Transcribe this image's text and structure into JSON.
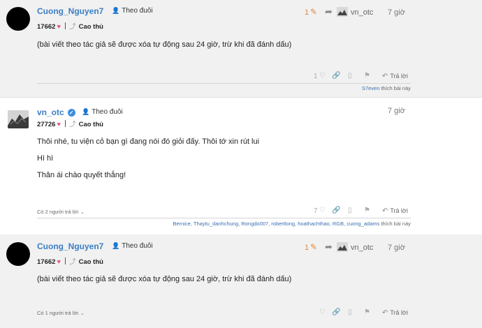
{
  "posts": [
    {
      "username": "Cuong_Nguyen7",
      "follow_label": "Theo đuôi",
      "points": "17662",
      "rank": "Cao thủ",
      "body": [
        "(bài viết theo tác giả sẽ được xóa tự động sau 24 giờ, trừ khi đã đánh dấu)"
      ],
      "edit_count": "1",
      "reply_to_user": "vn_otc",
      "time": "7 giờ",
      "like_count": "1",
      "reply_label": "Trả lời",
      "liked_by_user": "S7even",
      "liked_suffix": "thích bài này"
    },
    {
      "username": "vn_otc",
      "follow_label": "Theo đuôi",
      "points": "27726",
      "rank": "Cao thủ",
      "body": [
        "Thôi nhé, tu viện cỏ bạn gì đang nói đó giỏi đấy. Thôi tớ xin rút lui",
        "Hì hì",
        "Thân ái chào quyết thắng!"
      ],
      "time": "7 giờ",
      "like_count": "7",
      "reply_label": "Trả lời",
      "replies_summary": "Có 2 người trả lời",
      "likers": "Bernice, Thaytu_danhchung, Rongdo007, robertlong, hoathachthao, RGB, cuong_adams",
      "liked_suffix": "thích bài này"
    },
    {
      "username": "Cuong_Nguyen7",
      "follow_label": "Theo đuôi",
      "points": "17662",
      "rank": "Cao thủ",
      "body": [
        "(bài viết theo tác giả sẽ được xóa tự động sau 24 giờ, trừ khi đã đánh dấu)"
      ],
      "edit_count": "1",
      "reply_to_user": "vn_otc",
      "time": "7 giờ",
      "reply_label": "Trả lời",
      "replies_summary": "Có 1 người trả lời"
    }
  ],
  "icons": {
    "follow": "person-plus-icon",
    "heart": "heart-icon",
    "rank": "trending-icon",
    "edit": "pencil-icon",
    "reply_arrow": "share-arrow-icon",
    "link": "link-icon",
    "bookmark": "bookmark-icon",
    "flag": "flag-icon",
    "reply": "reply-icon",
    "chevron": "chevron-down-icon",
    "verified": "verified-check-icon"
  },
  "colors": {
    "username": "#3b7fc4",
    "edit_accent": "#e8863b",
    "heart": "#e35a7a",
    "verified": "#3b8de0",
    "post_bg": "#f1f1f1"
  }
}
